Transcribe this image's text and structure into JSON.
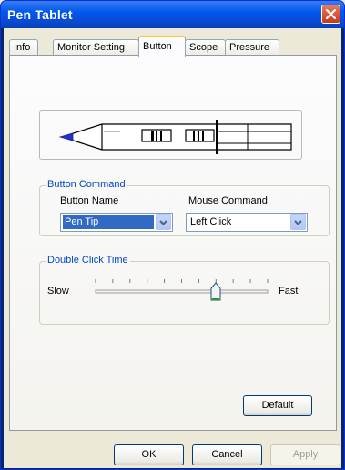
{
  "window": {
    "title": "Pen Tablet"
  },
  "tabs": [
    {
      "label": "Info"
    },
    {
      "label": "Monitor Setting"
    },
    {
      "label": "Button"
    },
    {
      "label": "Scope"
    },
    {
      "label": "Pressure"
    }
  ],
  "active_tab": "Button",
  "button_command": {
    "legend": "Button Command",
    "button_name_label": "Button Name",
    "button_name_value": "Pen Tip",
    "mouse_command_label": "Mouse Command",
    "mouse_command_value": "Left Click"
  },
  "double_click": {
    "legend": "Double Click Time",
    "slow_label": "Slow",
    "fast_label": "Fast",
    "slider_position": 0.6
  },
  "buttons": {
    "default": "Default",
    "ok": "OK",
    "cancel": "Cancel",
    "apply": "Apply"
  },
  "colors": {
    "titlebar": "#0058EE",
    "selection": "#316AC5",
    "group_legend": "#0046D5"
  }
}
